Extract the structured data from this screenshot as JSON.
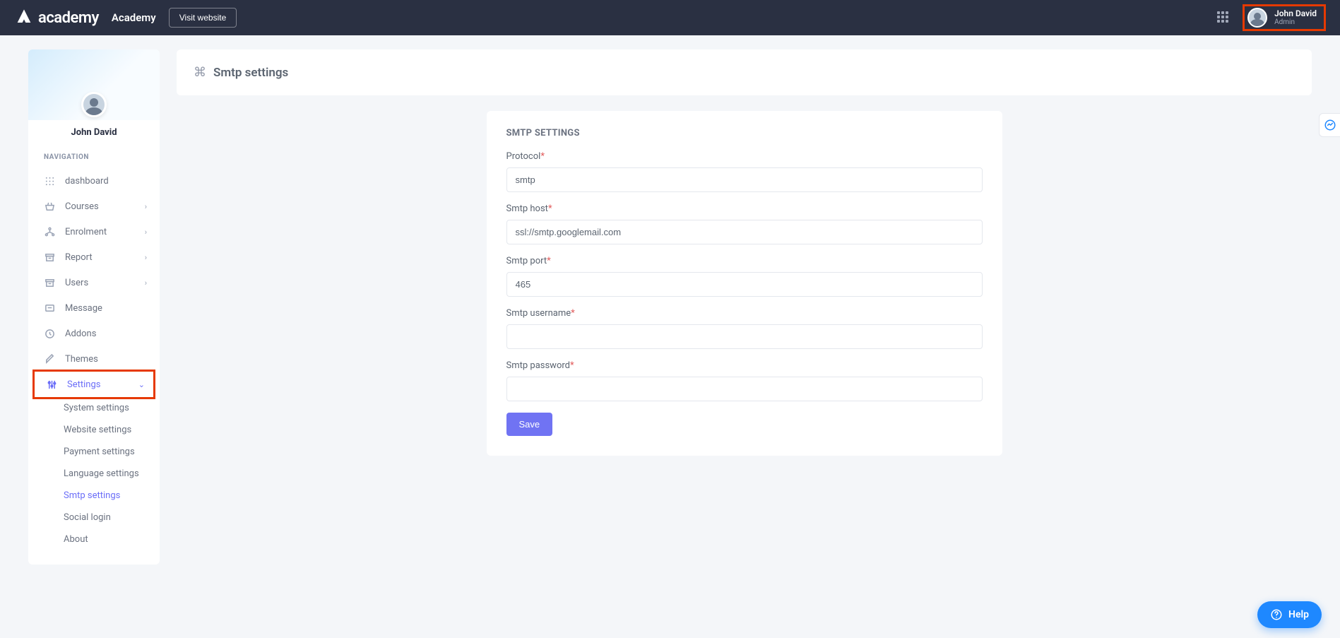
{
  "header": {
    "logo_text": "academy",
    "brand": "Academy",
    "visit_btn": "Visit website",
    "user_name": "John David",
    "user_role": "Admin"
  },
  "sidebar": {
    "user_name": "John David",
    "nav_heading": "NAVIGATION",
    "items": {
      "dashboard": "dashboard",
      "courses": "Courses",
      "enrolment": "Enrolment",
      "report": "Report",
      "users": "Users",
      "message": "Message",
      "addons": "Addons",
      "themes": "Themes",
      "settings": "Settings"
    },
    "sub": {
      "system": "System settings",
      "website": "Website settings",
      "payment": "Payment settings",
      "language": "Language settings",
      "smtp": "Smtp settings",
      "social": "Social login",
      "about": "About"
    }
  },
  "page": {
    "title": "Smtp settings",
    "card_title": "SMTP SETTINGS",
    "fields": {
      "protocol_label": "Protocol",
      "protocol_value": "smtp",
      "host_label": "Smtp host",
      "host_value": "ssl://smtp.googlemail.com",
      "port_label": "Smtp port",
      "port_value": "465",
      "user_label": "Smtp username",
      "user_value": "",
      "pass_label": "Smtp password",
      "pass_value": ""
    },
    "save": "Save"
  },
  "help_label": "Help"
}
